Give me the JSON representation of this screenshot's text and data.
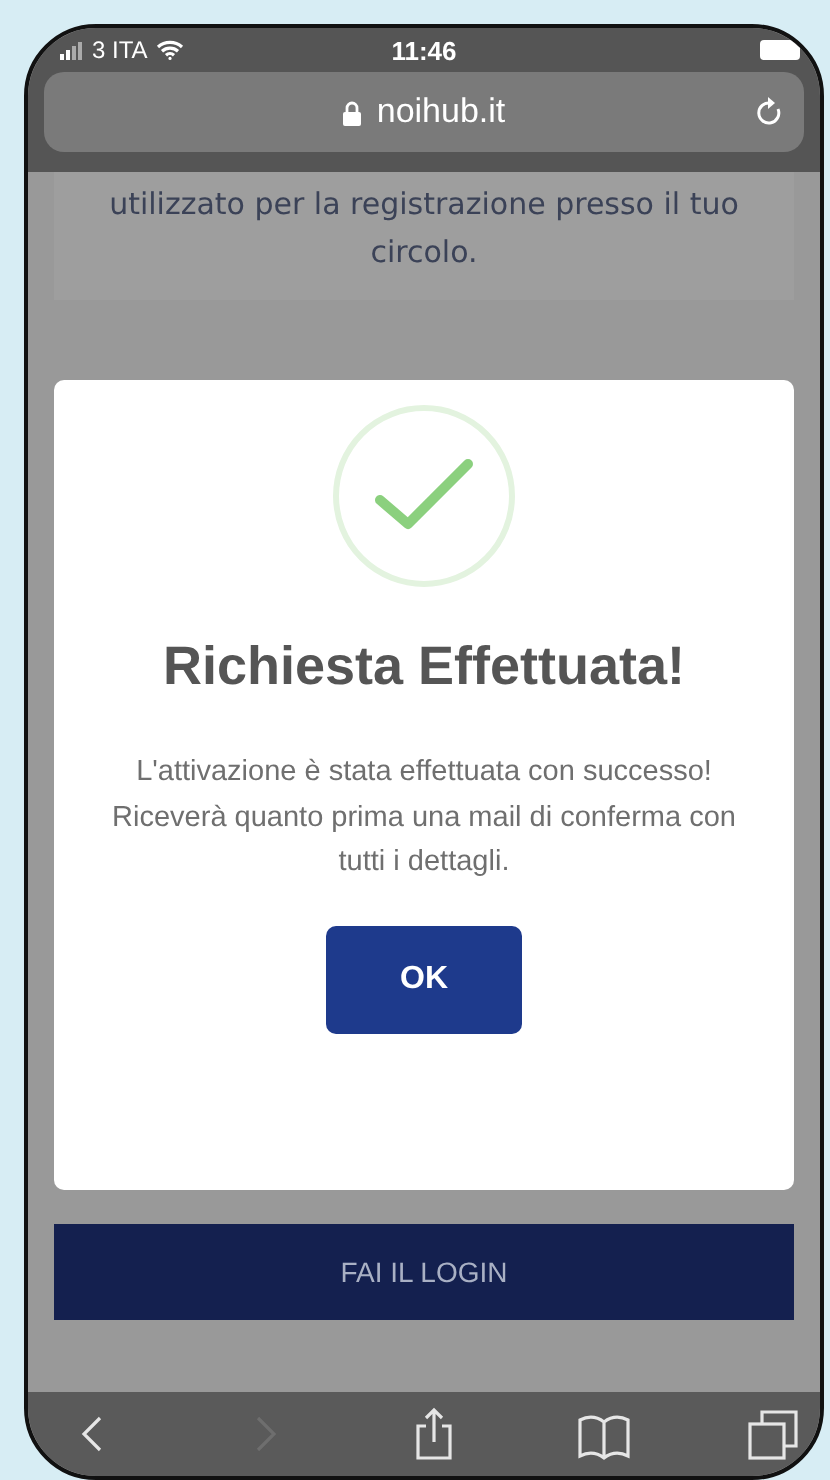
{
  "status_bar": {
    "carrier": "3 ITA",
    "time": "11:46"
  },
  "address_bar": {
    "url": "noihub.it"
  },
  "page": {
    "notice_text": "utilizzato per la registrazione presso il tuo circolo.",
    "login_button": "FAI IL LOGIN"
  },
  "dialog": {
    "title": "Richiesta Effettuata!",
    "message": "L'attivazione è stata effettuata con successo! Riceverà quanto prima una mail di conferma con tutti i dettagli.",
    "button": "OK"
  },
  "toolbar": {
    "items": [
      {
        "kind": "back",
        "disabled": false
      },
      {
        "kind": "forward",
        "disabled": true
      },
      {
        "kind": "share",
        "disabled": false
      },
      {
        "kind": "bookmarks",
        "disabled": false
      },
      {
        "kind": "tabs",
        "disabled": false
      }
    ]
  }
}
